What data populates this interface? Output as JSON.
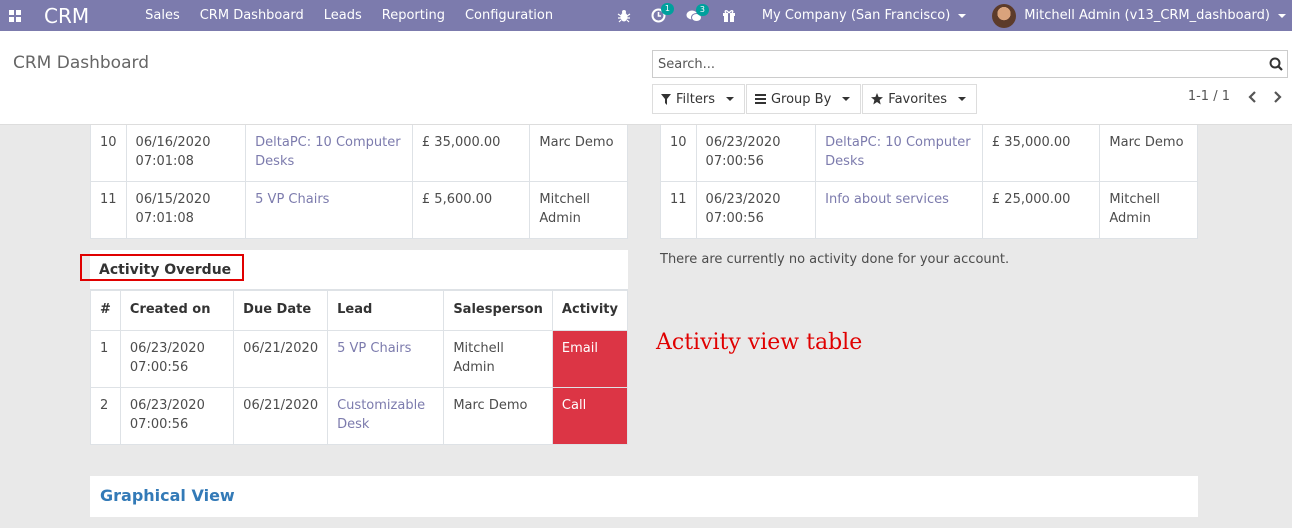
{
  "navbar": {
    "brand": "CRM",
    "menu": [
      "Sales",
      "CRM Dashboard",
      "Leads",
      "Reporting",
      "Configuration"
    ],
    "activity_badge": "1",
    "messages_badge": "3",
    "company": "My Company (San Francisco)",
    "user": "Mitchell Admin (v13_CRM_dashboard)"
  },
  "control_panel": {
    "title": "CRM Dashboard",
    "search_placeholder": "Search...",
    "filters_label": "Filters",
    "groupby_label": "Group By",
    "favorites_label": "Favorites",
    "pager": "1-1 / 1"
  },
  "left_table": {
    "rows": [
      {
        "num": "10",
        "date": "06/16/2020",
        "time": "07:01:08",
        "lead": "DeltaPC: 10 Computer Desks",
        "amount": "£ 35,000.00",
        "salesperson": "Marc Demo"
      },
      {
        "num": "11",
        "date": "06/15/2020",
        "time": "07:01:08",
        "lead": "5 VP Chairs",
        "amount": "£ 5,600.00",
        "salesperson": "Mitchell Admin"
      }
    ]
  },
  "right_table": {
    "rows": [
      {
        "num": "10",
        "date": "06/23/2020",
        "time": "07:00:56",
        "lead": "DeltaPC: 10 Computer Desks",
        "amount": "£ 35,000.00",
        "salesperson": "Marc Demo"
      },
      {
        "num": "11",
        "date": "06/23/2020",
        "time": "07:00:56",
        "lead": "Info about services",
        "amount": "£ 25,000.00",
        "salesperson": "Mitchell Admin"
      }
    ]
  },
  "activity_overdue": {
    "title": "Activity Overdue",
    "headers": [
      "#",
      "Created on",
      "Due Date",
      "Lead",
      "Salesperson",
      "Activity"
    ],
    "rows": [
      {
        "num": "1",
        "created_date": "06/23/2020",
        "created_time": "07:00:56",
        "due": "06/21/2020",
        "lead": "5 VP Chairs",
        "salesperson": "Mitchell Admin",
        "activity": "Email"
      },
      {
        "num": "2",
        "created_date": "06/23/2020",
        "created_time": "07:00:56",
        "due": "06/21/2020",
        "lead": "Customizable Desk",
        "salesperson": "Marc Demo",
        "activity": "Call"
      }
    ]
  },
  "no_activity_text": "There are currently no activity done for your account.",
  "annotation": "Activity view table",
  "graphical_view_title": "Graphical View",
  "icons": {
    "apps": "apps-grid-icon",
    "bug": "bug-icon",
    "activity": "clock-icon",
    "messages": "chat-icon",
    "gift": "gift-icon",
    "search": "search-icon",
    "filter": "filter-icon",
    "groupby": "bars-icon",
    "favorites": "star-icon"
  },
  "colors": {
    "navbar": "#7c7bad",
    "link": "#7c7bad",
    "activity_cell": "#dc3545",
    "annotation": "#e00000",
    "graph_title": "#337ab7"
  }
}
